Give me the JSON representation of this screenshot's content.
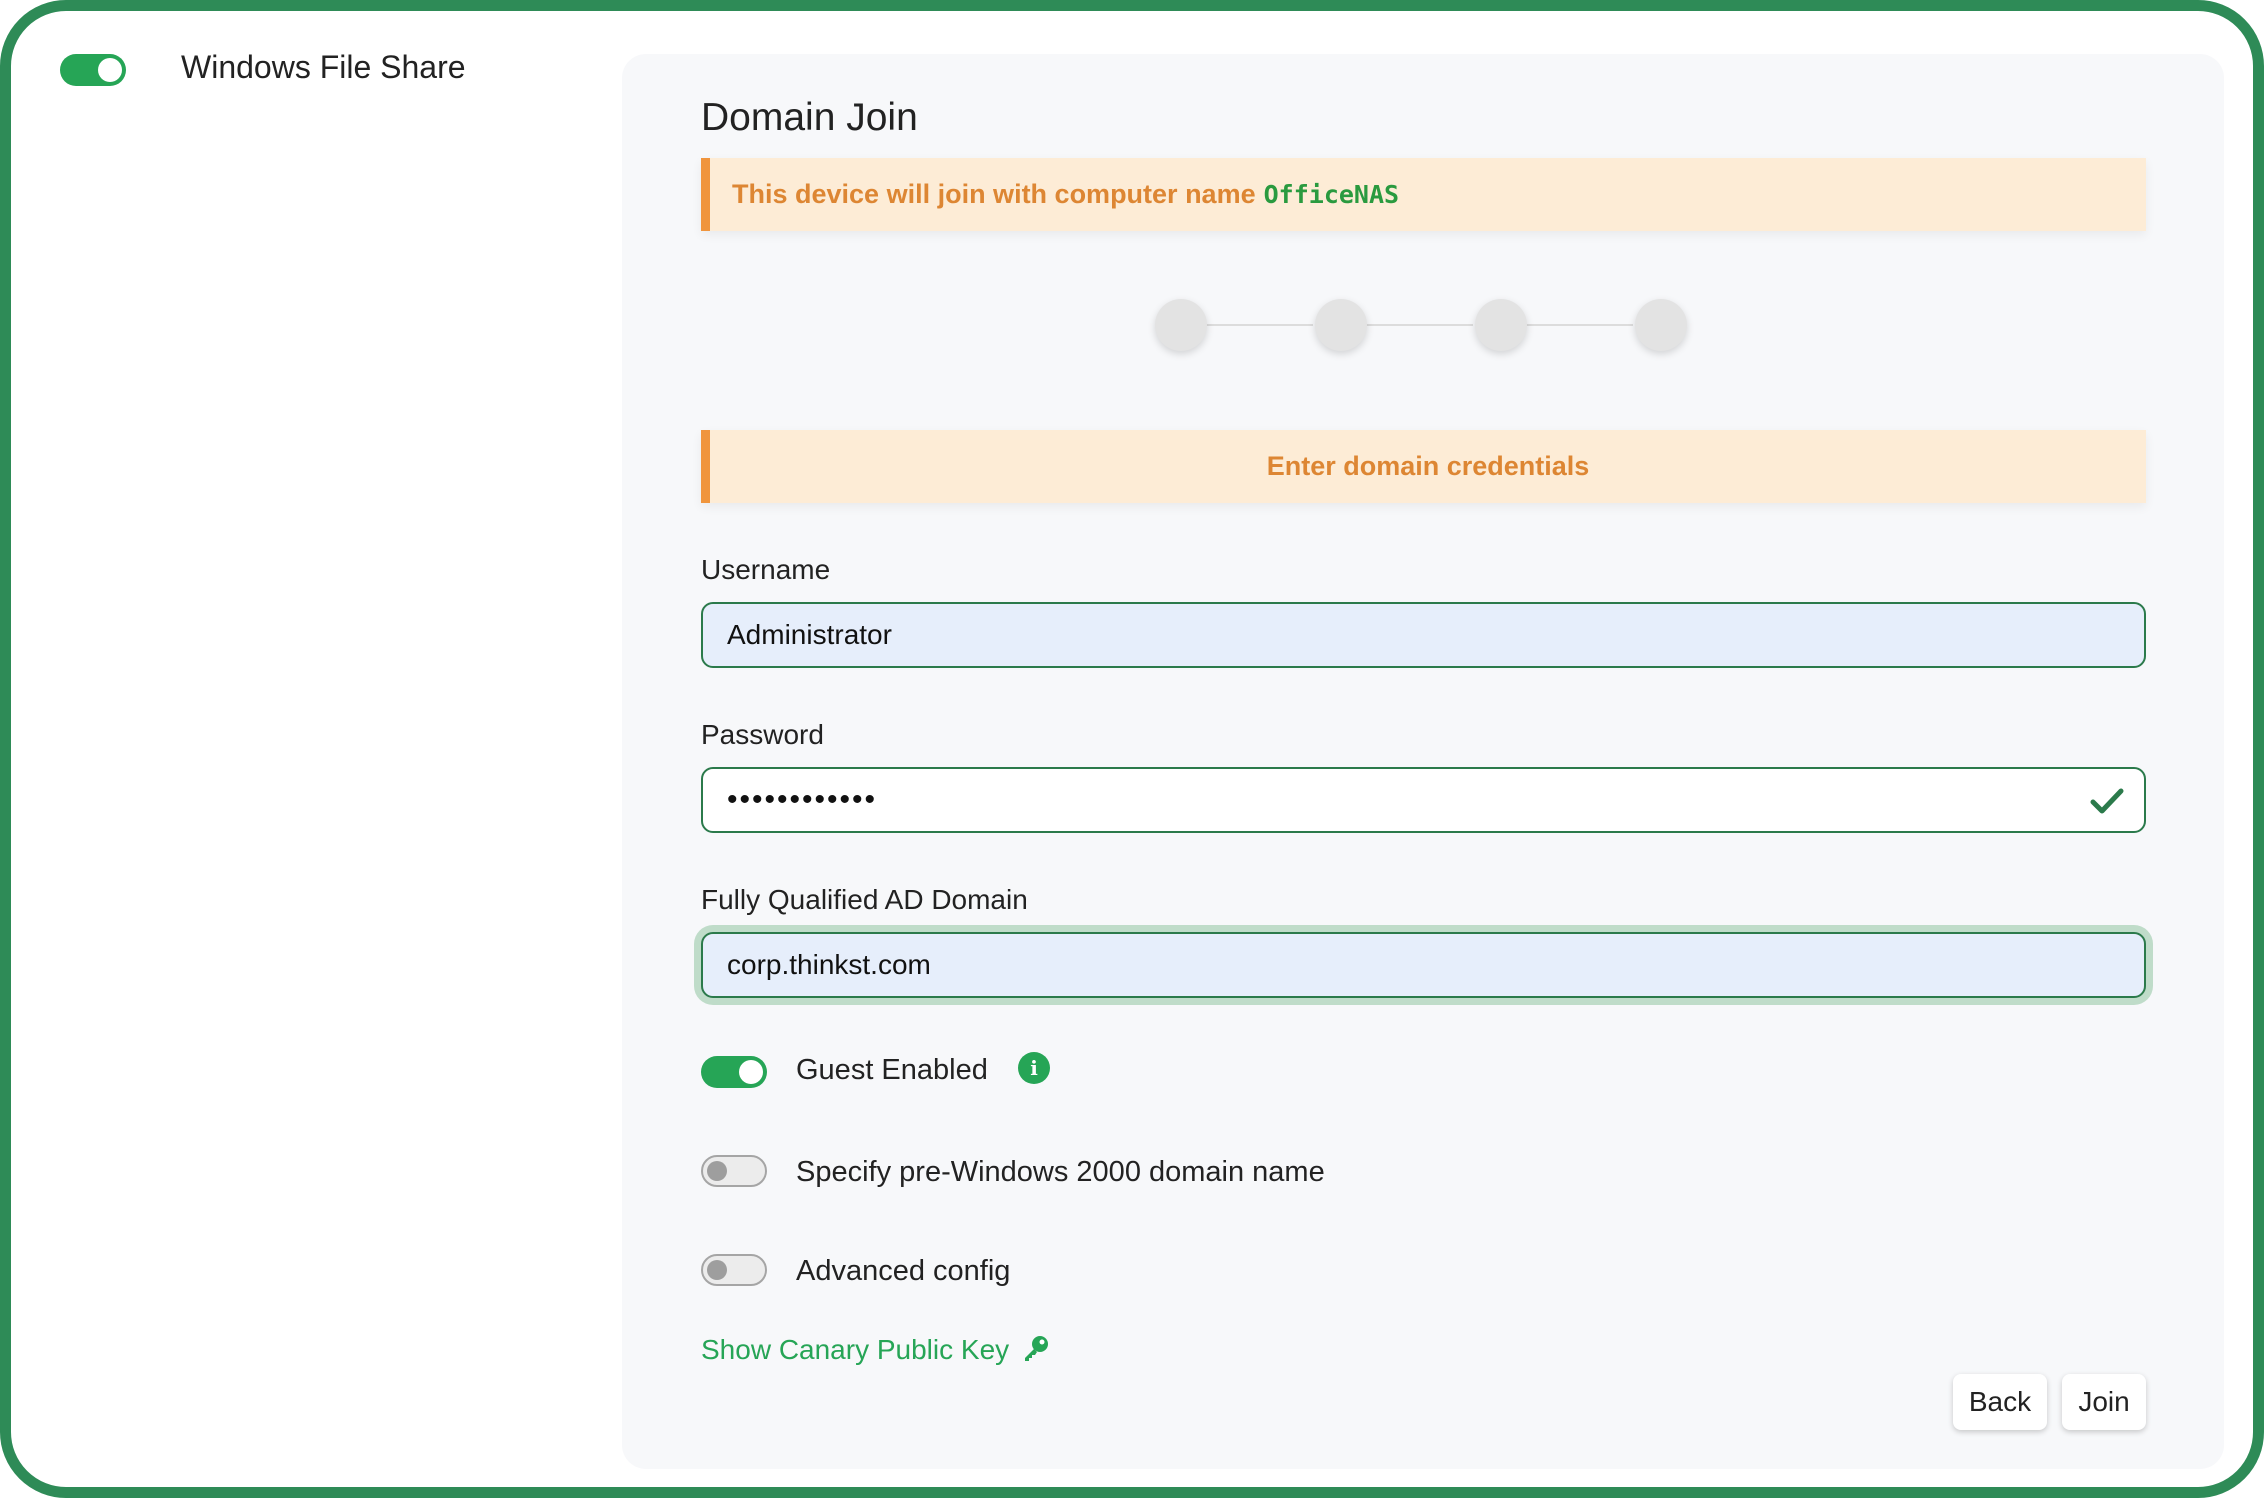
{
  "service": {
    "label": "Windows File Share",
    "enabled": true
  },
  "panel": {
    "title": "Domain Join",
    "computer_notice": {
      "prefix": "This device will join with computer name",
      "computer_name": "OfficeNAS"
    },
    "steps": {
      "count": 4
    },
    "step_notice": "Enter domain credentials",
    "username": {
      "label": "Username",
      "value": "Administrator"
    },
    "password": {
      "label": "Password",
      "value": "••••••••••••",
      "valid_icon": "checkmark-icon"
    },
    "domain": {
      "label": "Fully Qualified AD Domain",
      "value": "corp.thinkst.com"
    },
    "toggles": {
      "guest": {
        "label": "Guest Enabled",
        "on": true,
        "icon": "info-icon"
      },
      "pre_win2000": {
        "label": "Specify pre-Windows 2000 domain name",
        "on": false
      },
      "advanced": {
        "label": "Advanced config",
        "on": false
      }
    },
    "public_key_link": {
      "label": "Show Canary Public Key",
      "icon": "key-icon"
    },
    "buttons": {
      "back": "Back",
      "join": "Join"
    }
  },
  "colors": {
    "accent_green": "#26a556",
    "warning_orange": "#dd8633",
    "frame_green": "#2e8b57"
  }
}
